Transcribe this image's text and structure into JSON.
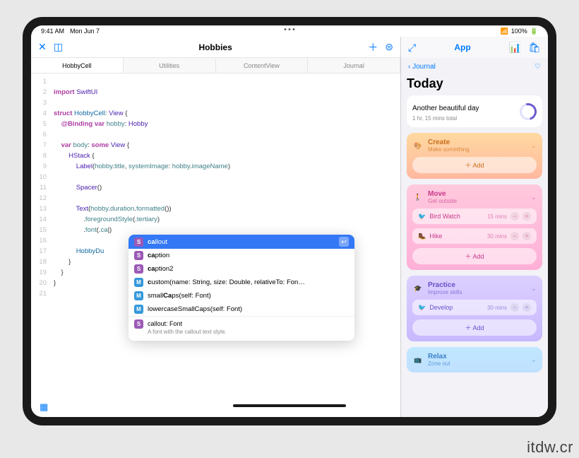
{
  "status": {
    "time": "9:41 AM",
    "date": "Mon Jun 7",
    "battery": "100%"
  },
  "left": {
    "title": "Hobbies",
    "tabs": [
      "HobbyCell",
      "Utilities",
      "ContentView",
      "Journal"
    ],
    "active_tab": 0,
    "code_lines": [
      "",
      "import SwiftUI",
      "",
      "struct HobbyCell: View {",
      "    @Binding var hobby: Hobby",
      "",
      "    var body: some View {",
      "        HStack {",
      "            Label(hobby.title, systemImage: hobby.imageName)",
      "",
      "            Spacer()",
      "",
      "            Text(hobby.duration.formatted())",
      "                .foregroundStyle(.tertiary)",
      "                .font(.ca|)",
      "",
      "            HobbyDu",
      "        }",
      "    }",
      "}",
      ""
    ],
    "autocomplete": {
      "typed": "ca",
      "items": [
        {
          "kind": "S",
          "prefix": "ca",
          "rest": "llout",
          "selected": true
        },
        {
          "kind": "S",
          "prefix": "ca",
          "rest": "ption"
        },
        {
          "kind": "S",
          "prefix": "ca",
          "rest": "ption2"
        },
        {
          "kind": "M",
          "prefix": "c",
          "rest": "ustom(name: String, size: Double, relativeTo: Fon…"
        },
        {
          "kind": "M",
          "prefix": "",
          "rest": "small",
          "bold": "Ca",
          "rest2": "ps(self: Font)"
        },
        {
          "kind": "M",
          "prefix": "",
          "rest": "lowercaseSmallCaps(self: Font)"
        }
      ],
      "footer_sig": "callout: Font",
      "footer_desc": "A font with the callout text style."
    }
  },
  "right": {
    "title": "App",
    "back": "Journal",
    "heading": "Today",
    "today_entry": "Another beautiful day",
    "today_sub": "1 hr, 15 mins total",
    "sections": [
      {
        "cls": "create",
        "icon": "🎨",
        "title": "Create",
        "sub": "Make something",
        "items": [],
        "add": "Add"
      },
      {
        "cls": "move",
        "icon": "🚶",
        "title": "Move",
        "sub": "Get outside",
        "items": [
          {
            "icon": "🐦",
            "label": "Bird Watch",
            "dur": "15 mins"
          },
          {
            "icon": "🥾",
            "label": "Hike",
            "dur": "30 mins"
          }
        ],
        "add": "Add"
      },
      {
        "cls": "practice",
        "icon": "🎓",
        "title": "Practice",
        "sub": "Improve skills",
        "items": [
          {
            "icon": "🐦",
            "label": "Develop",
            "dur": "30 mins"
          }
        ],
        "add": "Add"
      },
      {
        "cls": "relax",
        "icon": "📺",
        "title": "Relax",
        "sub": "Zone out",
        "items": [],
        "collapsed": true
      }
    ]
  },
  "watermark": "itdw.cr"
}
